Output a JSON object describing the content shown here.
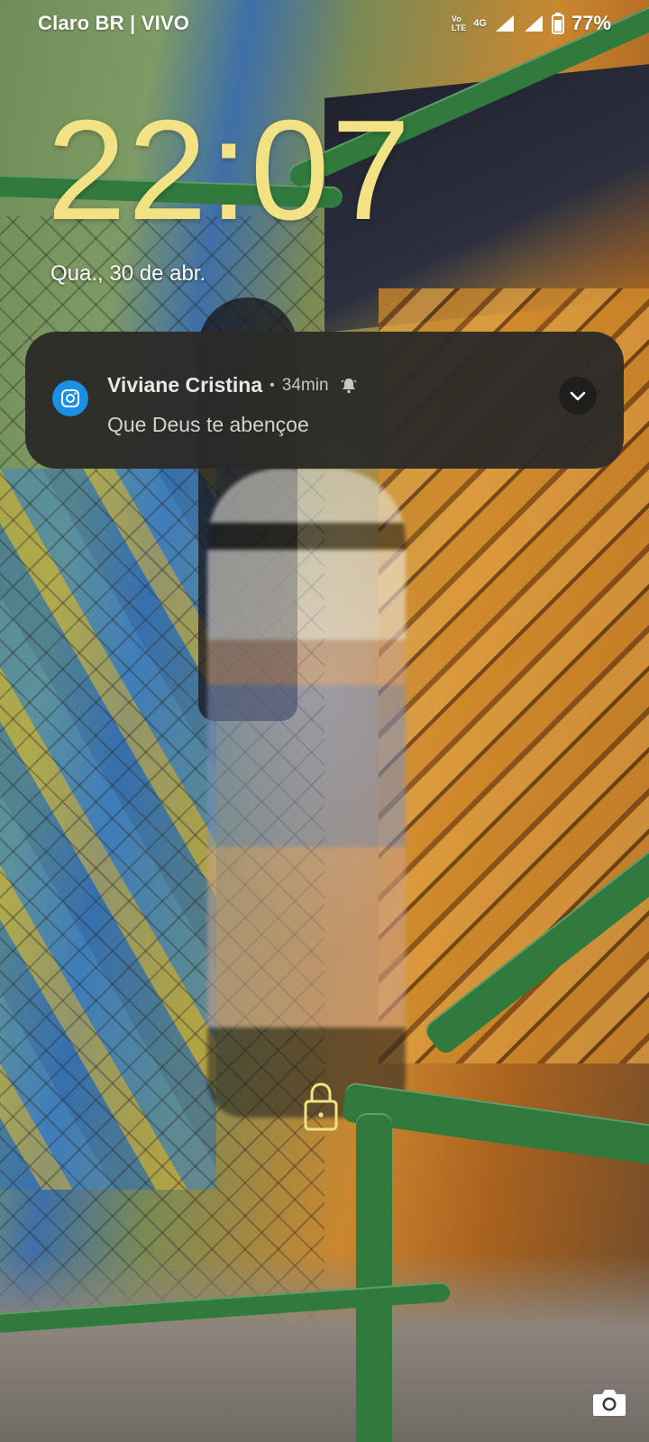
{
  "status_bar": {
    "carrier": "Claro BR | VIVO",
    "volte_top": "Vo",
    "volte_bottom": "LTE",
    "network": "4G",
    "battery": "77%",
    "icons": [
      "volte-icon",
      "signal-icon",
      "signal-icon",
      "battery-icon"
    ]
  },
  "lock_screen": {
    "time": "22:07",
    "date": "Qua., 30 de abr."
  },
  "notification": {
    "app_icon": "instagram-icon",
    "sender": "Viviane Cristina",
    "separator": "•",
    "time_ago": "34min",
    "bell_icon": "alert-bell-icon",
    "message": "Que Deus te abençoe",
    "expand_icon": "chevron-down-icon"
  },
  "bottom": {
    "lock_icon": "lock-icon",
    "camera_icon": "camera-icon"
  },
  "colors": {
    "clock": "#f3e283",
    "notification_bg": "#2c2b28",
    "instagram_accent": "#1a8fe3"
  }
}
